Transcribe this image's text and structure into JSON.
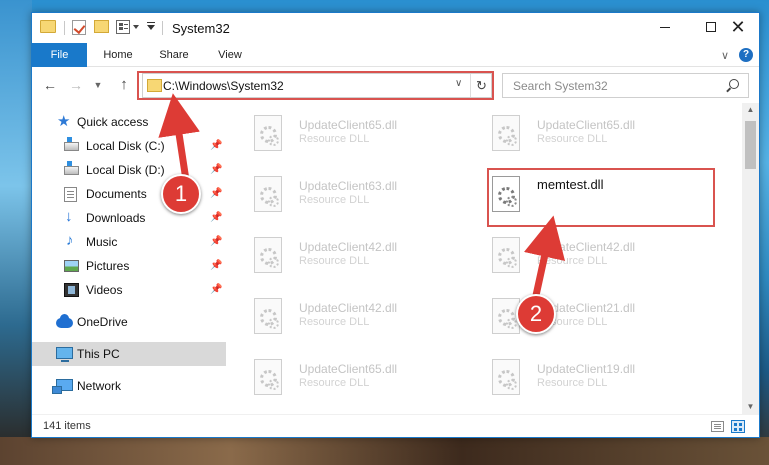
{
  "window": {
    "title": "System32",
    "controls": {
      "close": "✕"
    }
  },
  "ribbon": {
    "tabs": [
      "File",
      "Home",
      "Share",
      "View"
    ],
    "help": "?"
  },
  "navigation": {
    "address": "C:\\Windows\\System32",
    "search_placeholder": "Search System32"
  },
  "sidebar": {
    "items": [
      {
        "label": "Quick access",
        "icon": "star-icon",
        "pinned": false
      },
      {
        "label": "Local Disk (C:)",
        "icon": "drive-icon",
        "pinned": true
      },
      {
        "label": "Local Disk (D:)",
        "icon": "drive-icon",
        "pinned": true
      },
      {
        "label": "Documents",
        "icon": "documents-icon",
        "pinned": true
      },
      {
        "label": "Downloads",
        "icon": "download-icon",
        "pinned": true
      },
      {
        "label": "Music",
        "icon": "music-icon",
        "pinned": true
      },
      {
        "label": "Pictures",
        "icon": "pictures-icon",
        "pinned": true
      },
      {
        "label": "Videos",
        "icon": "videos-icon",
        "pinned": true
      },
      {
        "label": "OneDrive",
        "icon": "cloud-icon",
        "pinned": false
      },
      {
        "label": "This PC",
        "icon": "computer-icon",
        "pinned": false,
        "selected": true
      },
      {
        "label": "Network",
        "icon": "network-icon",
        "pinned": false
      }
    ]
  },
  "files": [
    {
      "name": "UpdateClient65.dll",
      "type": "Resource DLL"
    },
    {
      "name": "UpdateClient65.dll",
      "type": "Resource DLL"
    },
    {
      "name": "UpdateClient63.dll",
      "type": "Resource DLL"
    },
    {
      "name": "memtest.dll",
      "type": ""
    },
    {
      "name": "UpdateClient42.dll",
      "type": "Resource DLL"
    },
    {
      "name": "UpdateClient42.dll",
      "type": "Resource DLL"
    },
    {
      "name": "UpdateClient42.dll",
      "type": "Resource DLL"
    },
    {
      "name": "UpdateClient21.dll",
      "type": "Resource DLL"
    },
    {
      "name": "UpdateClient65.dll",
      "type": "Resource DLL"
    },
    {
      "name": "UpdateClient19.dll",
      "type": "Resource DLL"
    }
  ],
  "status": {
    "item_count": "141 items"
  },
  "annotations": {
    "step1": "1",
    "step2": "2",
    "color": "#d9534f"
  }
}
